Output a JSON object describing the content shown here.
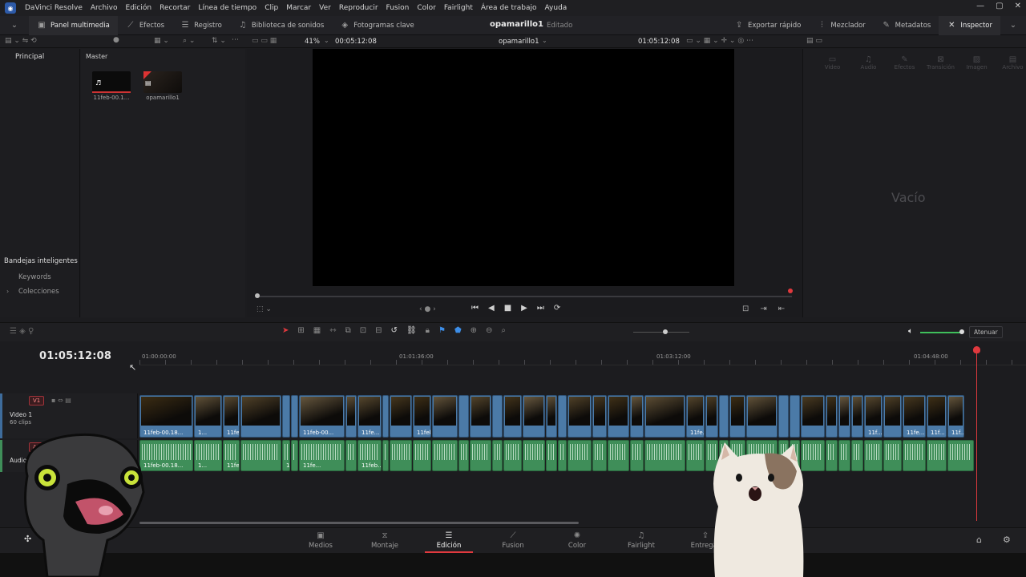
{
  "app": {
    "title": "DaVinci Resolve"
  },
  "menu": [
    "Archivo",
    "Edición",
    "Recortar",
    "Línea de tiempo",
    "Clip",
    "Marcar",
    "Ver",
    "Reproducir",
    "Fusion",
    "Color",
    "Fairlight",
    "Área de trabajo",
    "Ayuda"
  ],
  "toolbar": {
    "media_pool": "Panel multimedia",
    "effects": "Efectos",
    "edit_index": "Registro",
    "sound_library": "Biblioteca de sonidos",
    "keyframes": "Fotogramas clave",
    "project_title": "opamarillo1",
    "project_status": "Editado",
    "quick_export": "Exportar rápido",
    "mixer": "Mezclador",
    "metadata": "Metadatos",
    "inspector": "Inspector"
  },
  "viewer": {
    "zoom": "41%",
    "timecode_left": "00:05:12:08",
    "timeline_name": "opamarillo1",
    "timecode_right": "01:05:12:08"
  },
  "media_pool": {
    "tab_main": "Principal",
    "tab_master": "Master",
    "clips": [
      "11feb-00.1...",
      "opamarillo1"
    ],
    "smart_bins": "Bandejas inteligentes",
    "keywords": "Keywords",
    "collections": "Colecciones"
  },
  "inspector": {
    "tabs": [
      "Video",
      "Audio",
      "Efectos",
      "Transición",
      "Imagen",
      "Archivo"
    ],
    "empty_label": "Vacío"
  },
  "timeline": {
    "timecode": "01:05:12:08",
    "ruler": [
      "01:00:00:00",
      "01:01:36:00",
      "01:03:12:00",
      "01:04:48:00"
    ],
    "video_track": {
      "badge": "V1",
      "name": "Video 1",
      "clips_count": "60 clips"
    },
    "audio_track": {
      "badge": "A1",
      "name": "Audio 1"
    },
    "dim_button": "Atenuar",
    "video_clip_labels": [
      "11feb-00.18...",
      "1...",
      "11feb-...",
      "11feb-00...",
      "11fe...",
      "11feb...",
      "11fe...",
      "11f...",
      "11fe...",
      "11f...",
      "11f...",
      "11fe...",
      "11f...",
      "1..."
    ],
    "audio_clip_labels": [
      "11feb-00.18...",
      "1...",
      "11feb-...",
      "11feb-00...",
      "11fe...",
      "11feb..."
    ]
  },
  "pages": [
    "Medios",
    "Montaje",
    "Edición",
    "Fusion",
    "Color",
    "Fairlight",
    "Entregar"
  ],
  "active_page": "Edición",
  "colors": {
    "accent": "#e0393e",
    "video_clip": "#4b7aa7",
    "audio_clip": "#3f8e59"
  }
}
